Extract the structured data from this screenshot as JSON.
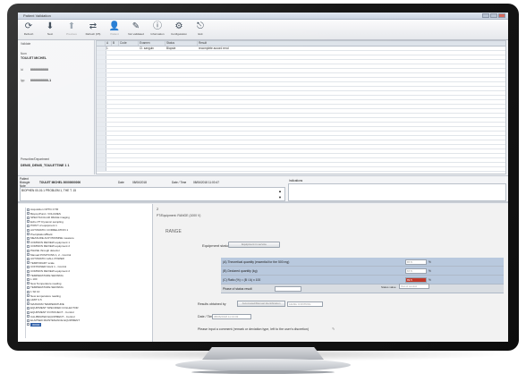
{
  "window": {
    "title": "Patient Validation"
  },
  "toolbar": [
    {
      "icon": "sync-icon",
      "glyph": "⟳",
      "label": "Refresh"
    },
    {
      "icon": "down-arrow-icon",
      "glyph": "⬇",
      "label": "Next"
    },
    {
      "icon": "up-arrow-icon",
      "glyph": "⬆",
      "label": "Previous",
      "dim": true
    },
    {
      "icon": "swap-icon",
      "glyph": "⇄",
      "label": "Refresh (F5)"
    },
    {
      "icon": "user-icon",
      "glyph": "👤",
      "label": "Patient",
      "dim": true
    },
    {
      "icon": "edit-icon",
      "glyph": "✎",
      "label": "Not validated"
    },
    {
      "icon": "info-icon",
      "glyph": "ⓘ",
      "label": "Information"
    },
    {
      "icon": "settings-icon",
      "glyph": "⚙",
      "label": "Configuration"
    },
    {
      "icon": "exit-icon",
      "glyph": "⎋",
      "label": "Exit"
    }
  ],
  "left_panel": {
    "heading": "Validate",
    "name_label": "Nom",
    "name_value": "TOULET MICHEL",
    "id1_label": "Id",
    "id1_value": "0000000000",
    "id2_label": "Ipp",
    "id2_value": "0000000000-1",
    "footer_label": "Prescriber/Department",
    "footer_value": "DENIS_DENIS_TOULETTINE 1 1"
  },
  "grid": {
    "headers": [
      "",
      "A",
      "B",
      "Code",
      "Examen",
      "Status",
      "Result"
    ],
    "rows": [
      {
        "a": "1",
        "b": "",
        "code": "",
        "exam": "Cl. sanguin",
        "status": "Biopsie",
        "result": "recomplete accord rend"
      }
    ]
  },
  "bottom_info": {
    "label1": "Patient",
    "value1": "Biologie",
    "row2": "TOULET MICHEL 00000000000",
    "date_label": "Date",
    "date_value": "08/06/2018",
    "time_label": "Date / Time",
    "time_value": "08/06/2018 11:00:47",
    "note_label": "Note",
    "note_text": "BIOPHEN 00-01:1 PROBLEM 1, THE T. 15",
    "annotation_label": "Indications"
  },
  "tree": {
    "items": [
      "Acquisition OPTIC KTR",
      "Biopsy/Punct. VOLUMES",
      "SPECTACULAR IMAGE imaging",
      "Echo PT Dynamic sampling",
      "PIONT of equipment 1",
      "AUTOMATIC CORRELATION 1",
      "Precipitation/Block",
      "MEASURE ACP PROMISE measure",
      "COMMON REVIEW equipment 1",
      "COMMON REVIEW equipment 2",
      "PHASE through detector",
      "Manual POSITIONS 1, 2 - Control",
      "AUTOMATIC HALL POWER",
      "TEMPORARY scale",
      "CONTAINER block 1 - Control",
      "COMMON REVIEW equipment 2",
      "TEMPERATURE SENSING",
      "L 100",
      "New Temperature reading",
      "TEMPERATURE SENSING",
      "1 S0 10",
      "New temperature reading",
      "LIMIT 0.5",
      "MAXIMUM TEMPERATURE",
      "EQUIPMENT SPECIFIED COLLECTOR",
      "EQUIPMENT IN PROJECT - Control",
      "CALIBRATED EQUIPMENT - Control",
      "ELAPSED MAINTENANCE EQUIPMENT",
      "00000"
    ],
    "selected_index": 28
  },
  "detail": {
    "top_label": "2",
    "breadcrumb": "PT/Equipment: RANGE (1000 V)",
    "section": "RANGE",
    "equipment_status_label": "Equipment status",
    "equipment_status_button": "Equipment in service",
    "rows": [
      {
        "label": "(A) Theoretical quantity (essential for the 500 mg)",
        "value": "87.5",
        "unit": "%"
      },
      {
        "label": "(B) Declared quantity (kg)",
        "value": "67.5",
        "unit": "%"
      },
      {
        "label": "(C) Ratio (%) = (B / A) x 100",
        "value": "89.5",
        "unit": "%",
        "flag": true
      },
      {
        "label": "Phase of status result",
        "value": "",
        "unit": ""
      }
    ],
    "status_text_label": "Status value",
    "status_text_value": "Out of control",
    "results_label": "Results obtained by",
    "results_button": "Automated/Manual Identification",
    "results_box": "LEVEL CONTROL",
    "date_label": "Date / Time",
    "date_value": "08/06/2018 11:13:03",
    "comment_text": "Please input a comment (remark or deviation type, left to the user's discretion)"
  }
}
